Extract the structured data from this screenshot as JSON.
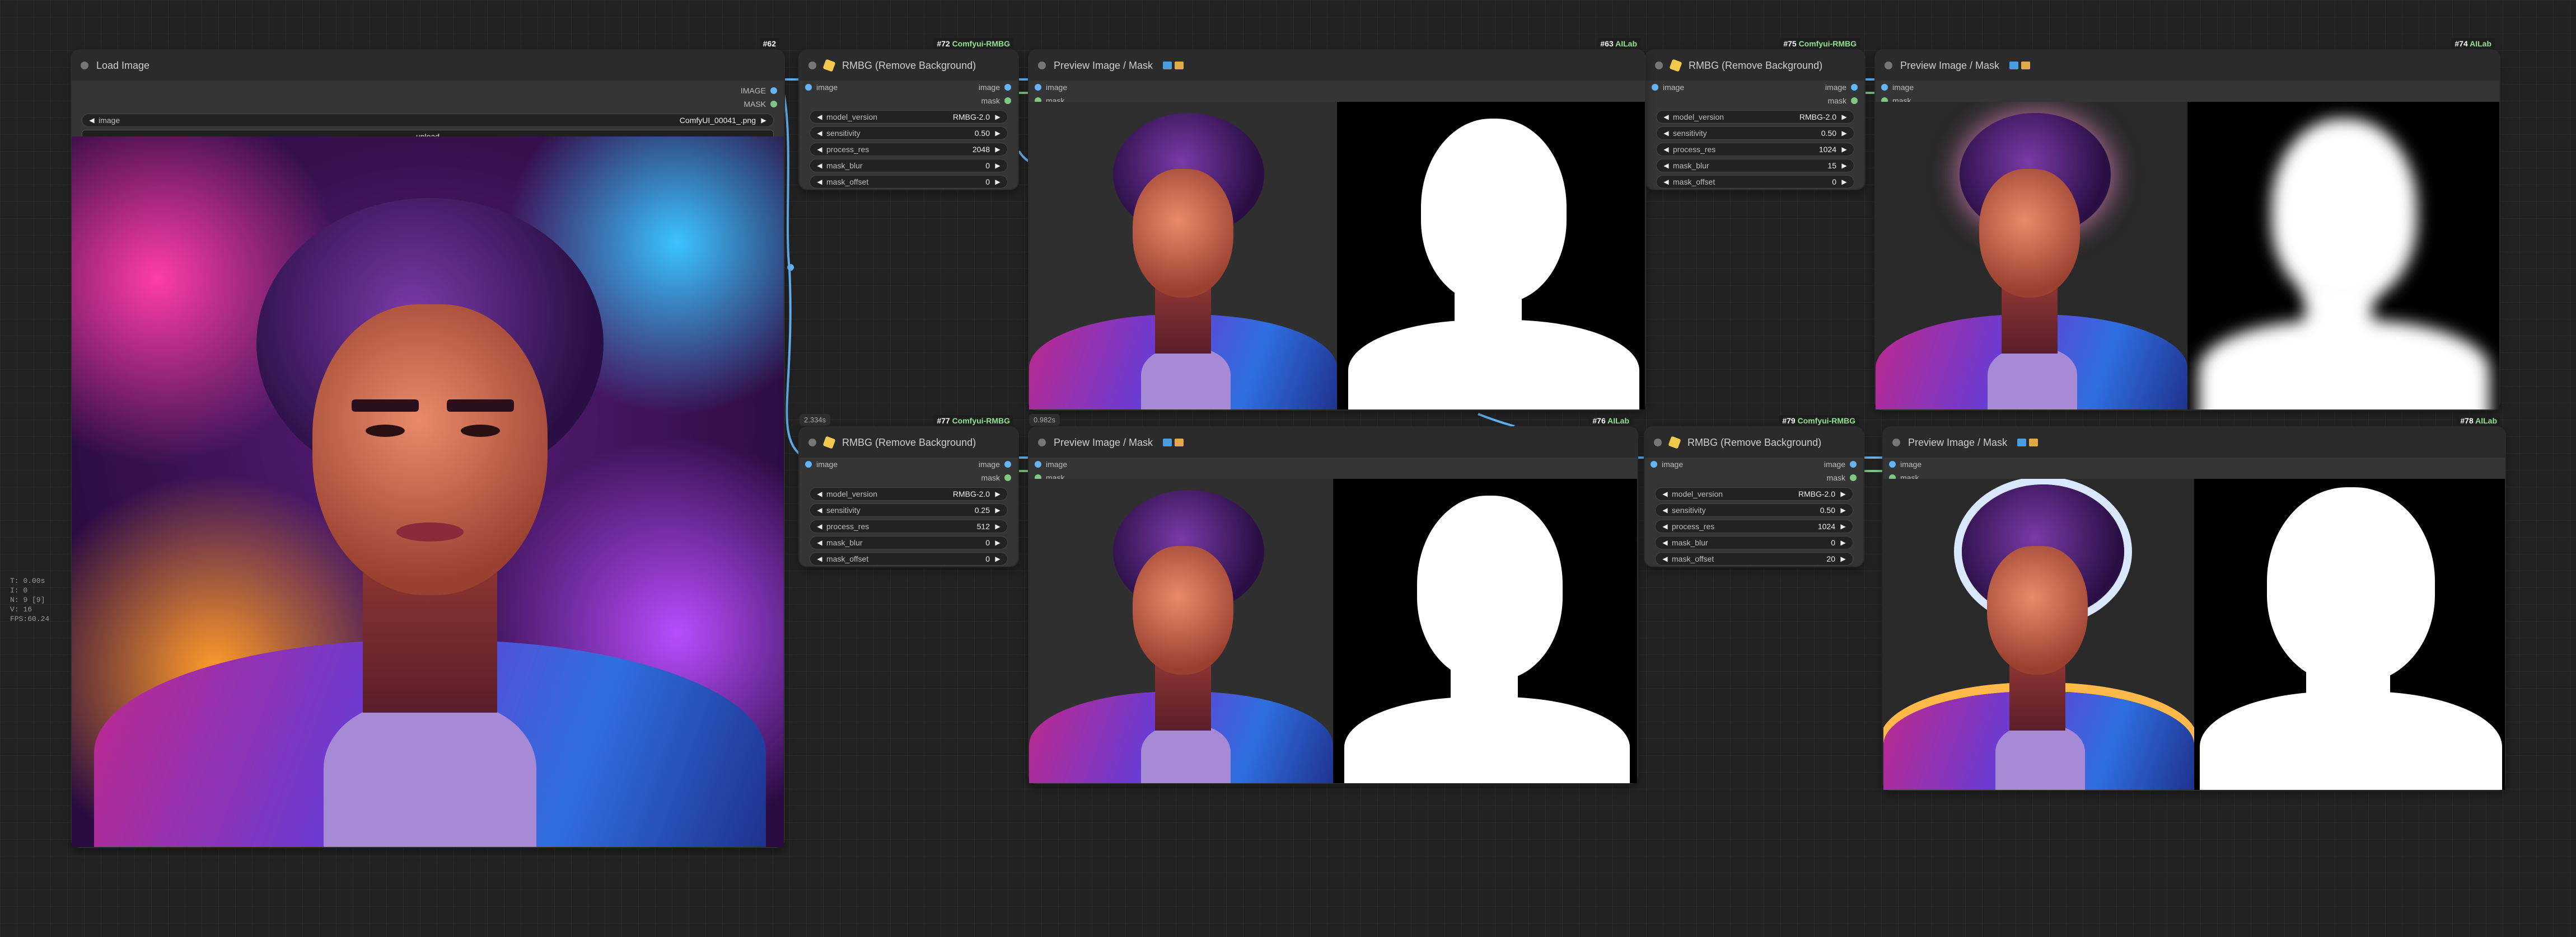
{
  "load_image": {
    "title": "Load Image",
    "id_badge": "#62",
    "outputs": [
      "IMAGE",
      "MASK"
    ],
    "image_widget_name": "image",
    "image_widget_value": "ComfyUI_00041_.png",
    "upload_label": "upload"
  },
  "rmbg_nodes": [
    {
      "title": "RMBG (Remove Background)",
      "id_badge": "#72",
      "source": "Comfyui-RMBG",
      "input": "image",
      "outputs": [
        "image",
        "mask"
      ],
      "widgets": [
        {
          "name": "model_version",
          "value": "RMBG-2.0"
        },
        {
          "name": "sensitivity",
          "value": "0.50"
        },
        {
          "name": "process_res",
          "value": "2048"
        },
        {
          "name": "mask_blur",
          "value": "0"
        },
        {
          "name": "mask_offset",
          "value": "0"
        }
      ]
    },
    {
      "title": "RMBG (Remove Background)",
      "id_badge": "#75",
      "source": "Comfyui-RMBG",
      "input": "image",
      "outputs": [
        "image",
        "mask"
      ],
      "widgets": [
        {
          "name": "model_version",
          "value": "RMBG-2.0"
        },
        {
          "name": "sensitivity",
          "value": "0.50"
        },
        {
          "name": "process_res",
          "value": "1024"
        },
        {
          "name": "mask_blur",
          "value": "15"
        },
        {
          "name": "mask_offset",
          "value": "0"
        }
      ]
    },
    {
      "title": "RMBG (Remove Background)",
      "id_badge": "#77",
      "source": "Comfyui-RMBG",
      "timer": "2.334s",
      "input": "image",
      "outputs": [
        "image",
        "mask"
      ],
      "widgets": [
        {
          "name": "model_version",
          "value": "RMBG-2.0"
        },
        {
          "name": "sensitivity",
          "value": "0.25"
        },
        {
          "name": "process_res",
          "value": "512"
        },
        {
          "name": "mask_blur",
          "value": "0"
        },
        {
          "name": "mask_offset",
          "value": "0"
        }
      ]
    },
    {
      "title": "RMBG (Remove Background)",
      "id_badge": "#79",
      "source": "Comfyui-RMBG",
      "input": "image",
      "outputs": [
        "image",
        "mask"
      ],
      "widgets": [
        {
          "name": "model_version",
          "value": "RMBG-2.0"
        },
        {
          "name": "sensitivity",
          "value": "0.50"
        },
        {
          "name": "process_res",
          "value": "1024"
        },
        {
          "name": "mask_blur",
          "value": "0"
        },
        {
          "name": "mask_offset",
          "value": "20"
        }
      ]
    }
  ],
  "preview_nodes": [
    {
      "title": "Preview Image / Mask",
      "id_badge": "#63",
      "source": "AILab",
      "inputs": [
        "image",
        "mask"
      ]
    },
    {
      "title": "Preview Image / Mask",
      "id_badge": "#74",
      "source": "AILab",
      "inputs": [
        "image",
        "mask"
      ]
    },
    {
      "title": "Preview Image / Mask",
      "id_badge": "#76",
      "source": "AILab",
      "timer": "0.982s",
      "inputs": [
        "image",
        "mask"
      ]
    },
    {
      "title": "Preview Image / Mask",
      "id_badge": "#78",
      "source": "AILab",
      "inputs": [
        "image",
        "mask"
      ]
    }
  ],
  "perf_stats": [
    "T: 0.00s",
    "I: 0",
    "N: 9 [9]",
    "V: 16",
    "FPS:60.24"
  ],
  "colors": {
    "canvas": "#222222",
    "node_body": "#353535",
    "node_title": "#2b2b2b",
    "image_link": "#64b5f6",
    "mask_link": "#81c784",
    "badge_source": "#8fe38f"
  }
}
